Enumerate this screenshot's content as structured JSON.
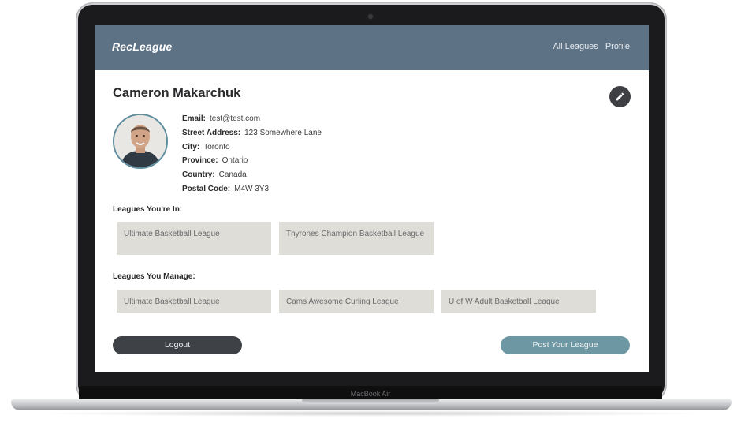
{
  "device": {
    "label": "MacBook Air"
  },
  "nav": {
    "logo": "RecLeague",
    "links": [
      {
        "label": "All Leagues"
      },
      {
        "label": "Profile"
      }
    ]
  },
  "profile": {
    "name": "Cameron Makarchuk",
    "details": [
      {
        "key": "Email:",
        "value": "test@test.com"
      },
      {
        "key": "Street Address:",
        "value": "123 Somewhere Lane"
      },
      {
        "key": "City:",
        "value": "Toronto"
      },
      {
        "key": "Province:",
        "value": "Ontario"
      },
      {
        "key": "Country:",
        "value": "Canada"
      },
      {
        "key": "Postal Code:",
        "value": "M4W 3Y3"
      }
    ]
  },
  "leagues_in": {
    "label": "Leagues You're In:",
    "items": [
      "Ultimate Basketball League",
      "Thyrones Champion Basketball League"
    ]
  },
  "leagues_manage": {
    "label": "Leagues You Manage:",
    "items": [
      "Ultimate Basketball League",
      "Cams Awesome Curling League",
      "U of W Adult Basketball League"
    ]
  },
  "actions": {
    "logout": "Logout",
    "post": "Post Your League"
  },
  "icons": {
    "edit": "pencil-icon"
  },
  "colors": {
    "navbar": "#5d7285",
    "card": "#deddd7",
    "logout": "#3e4145",
    "post": "#6d97a3",
    "avatar_border": "#5f8da0"
  }
}
